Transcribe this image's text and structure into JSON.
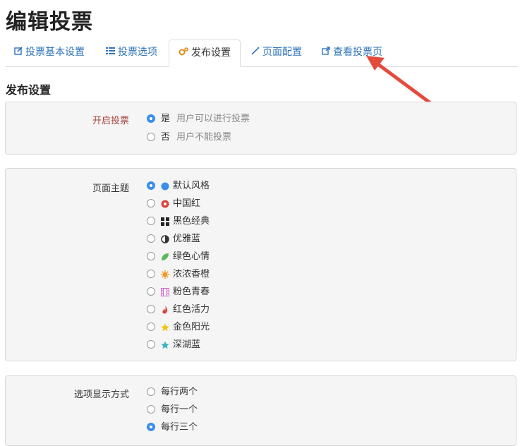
{
  "page_title": "编辑投票",
  "tabs": [
    {
      "label": "投票基本设置",
      "icon": "edit-icon"
    },
    {
      "label": "投票选项",
      "icon": "list-icon"
    },
    {
      "label": "发布设置",
      "icon": "gears-icon"
    },
    {
      "label": "页面配置",
      "icon": "magic-wand-icon"
    },
    {
      "label": "查看投票页",
      "icon": "external-link-icon"
    }
  ],
  "active_tab": "发布设置",
  "section_title": "发布设置",
  "enable_vote": {
    "label": "开启投票",
    "options": [
      {
        "label": "是",
        "hint": "用户可以进行投票",
        "checked": true
      },
      {
        "label": "否",
        "hint": "用户不能投票",
        "checked": false
      }
    ]
  },
  "theme": {
    "label": "页面主题",
    "options": [
      {
        "label": "默认风格",
        "icon": "circle-icon",
        "color": "#3b8fe8",
        "checked": true
      },
      {
        "label": "中国红",
        "icon": "red-badge-icon",
        "color": "#d9453d",
        "checked": false
      },
      {
        "label": "黑色经典",
        "icon": "grid-icon",
        "color": "#222222",
        "checked": false
      },
      {
        "label": "优雅蓝",
        "icon": "half-circle-icon",
        "color": "#333333",
        "checked": false
      },
      {
        "label": "绿色心情",
        "icon": "leaf-icon",
        "color": "#5cb85c",
        "checked": false
      },
      {
        "label": "浓浓香橙",
        "icon": "sun-icon",
        "color": "#f0961c",
        "checked": false
      },
      {
        "label": "粉色青春",
        "icon": "film-icon",
        "color": "#d660c8",
        "checked": false
      },
      {
        "label": "红色活力",
        "icon": "fire-icon",
        "color": "#d9453d",
        "checked": false
      },
      {
        "label": "金色阳光",
        "icon": "star-icon",
        "color": "#f1c40f",
        "checked": false
      },
      {
        "label": "深湖蓝",
        "icon": "star-icon",
        "color": "#3bb3c3",
        "checked": false
      }
    ]
  },
  "display_mode": {
    "label": "选项显示方式",
    "options": [
      {
        "label": "每行两个",
        "checked": false
      },
      {
        "label": "每行一个",
        "checked": false
      },
      {
        "label": "每行三个",
        "checked": true
      }
    ]
  }
}
